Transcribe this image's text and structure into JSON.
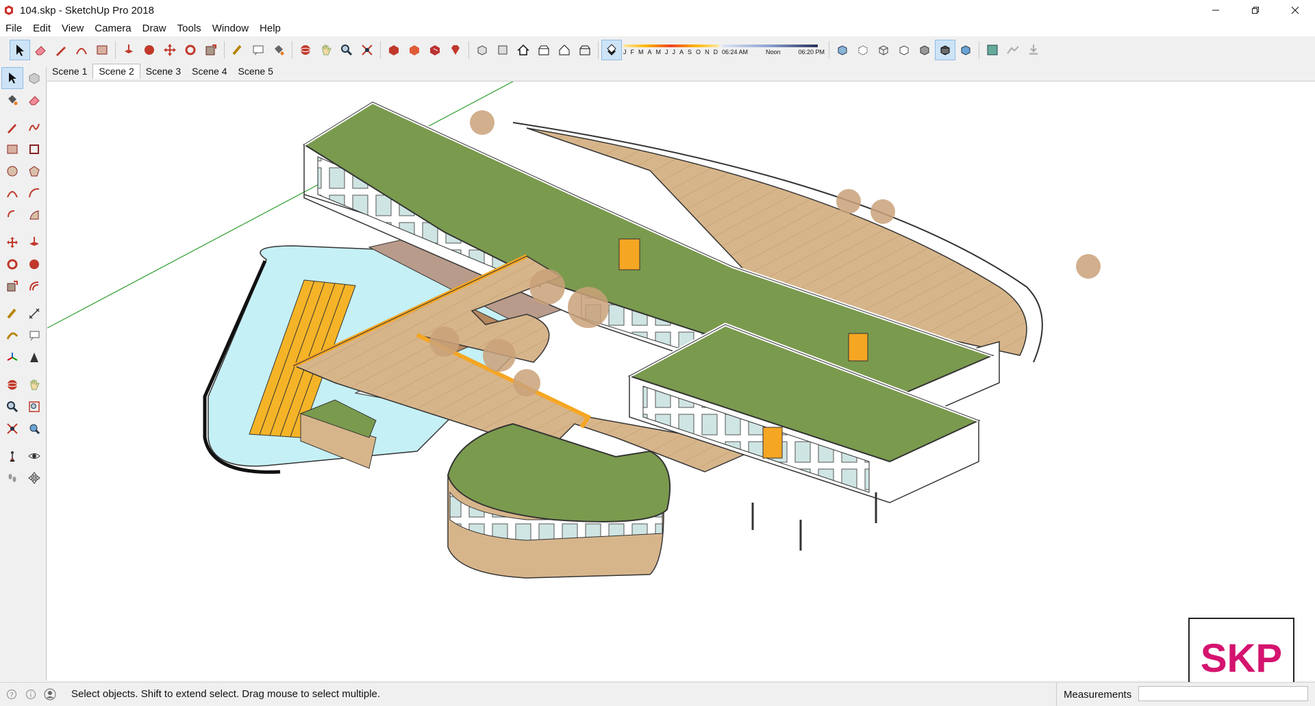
{
  "window": {
    "title": "104.skp - SketchUp Pro 2018",
    "icon": "sketchup-app-icon",
    "controls": [
      "minimize-icon",
      "restore-icon",
      "close-icon"
    ]
  },
  "menu": [
    "File",
    "Edit",
    "View",
    "Camera",
    "Draw",
    "Tools",
    "Window",
    "Help"
  ],
  "shadow_settings": {
    "months": [
      "J",
      "F",
      "M",
      "A",
      "M",
      "J",
      "J",
      "A",
      "S",
      "O",
      "N",
      "D"
    ],
    "sunrise": "06:24 AM",
    "noon": "Noon",
    "sunset": "06:20 PM"
  },
  "scenes": {
    "tabs": [
      "Scene 1",
      "Scene 2",
      "Scene 3",
      "Scene 4",
      "Scene 5"
    ],
    "active": "Scene 2"
  },
  "status": {
    "message": "Select objects. Shift to extend select. Drag mouse to select multiple.",
    "measurements_label": "Measurements",
    "measurements_value": ""
  },
  "watermark": {
    "text": "SKP"
  },
  "colors": {
    "roof_green": "#7a9a4e",
    "deck_wood": "#d9b991",
    "pool_water": "#c5f0f5",
    "orange_accent": "#f5a623",
    "axis_green": "#2e9e2e",
    "skp_magenta": "#d4146f"
  }
}
